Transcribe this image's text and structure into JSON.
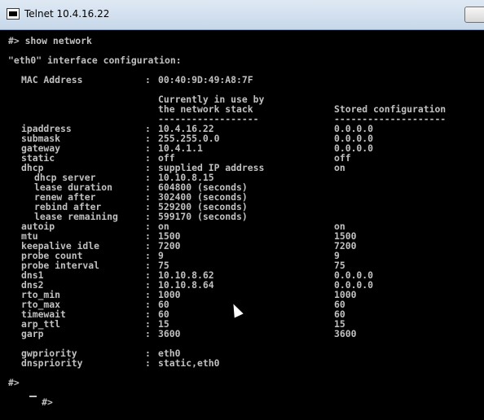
{
  "window": {
    "title": "Telnet 10.4.16.22"
  },
  "console": {
    "command_line": "#> show network",
    "header": "\"eth0\" interface configuration:",
    "mac": {
      "label": "MAC Address",
      "sep": ":",
      "value": "00:40:9D:49:A8:7F"
    },
    "col_current_1": "Currently in use by",
    "col_current_2": "the network stack",
    "col_stored": "Stored configuration",
    "divider_current": "------------------",
    "divider_stored": "--------------------",
    "rows": [
      {
        "label": "ipaddress",
        "indent": false,
        "current": "10.4.16.22",
        "stored": "0.0.0.0"
      },
      {
        "label": "submask",
        "indent": false,
        "current": "255.255.0.0",
        "stored": "0.0.0.0"
      },
      {
        "label": "gateway",
        "indent": false,
        "current": "10.4.1.1",
        "stored": "0.0.0.0"
      },
      {
        "label": "static",
        "indent": false,
        "current": "off",
        "stored": "off"
      },
      {
        "label": "dhcp",
        "indent": false,
        "current": "supplied IP address",
        "stored": "on"
      },
      {
        "label": "dhcp server",
        "indent": true,
        "current": "10.10.8.15",
        "stored": ""
      },
      {
        "label": "lease duration",
        "indent": true,
        "current": "604800 (seconds)",
        "stored": ""
      },
      {
        "label": "renew after",
        "indent": true,
        "current": "302400 (seconds)",
        "stored": ""
      },
      {
        "label": "rebind after",
        "indent": true,
        "current": "529200 (seconds)",
        "stored": ""
      },
      {
        "label": "lease remaining",
        "indent": true,
        "current": "599170 (seconds)",
        "stored": ""
      },
      {
        "label": "autoip",
        "indent": false,
        "current": "on",
        "stored": "on"
      },
      {
        "label": "mtu",
        "indent": false,
        "current": "1500",
        "stored": "1500"
      },
      {
        "label": "keepalive idle",
        "indent": false,
        "current": "7200",
        "stored": "7200"
      },
      {
        "label": "probe count",
        "indent": false,
        "current": "9",
        "stored": "9"
      },
      {
        "label": "probe interval",
        "indent": false,
        "current": "75",
        "stored": "75"
      },
      {
        "label": "dns1",
        "indent": false,
        "current": "10.10.8.62",
        "stored": "0.0.0.0"
      },
      {
        "label": "dns2",
        "indent": false,
        "current": "10.10.8.64",
        "stored": "0.0.0.0"
      },
      {
        "label": "rto_min",
        "indent": false,
        "current": "1000",
        "stored": "1000"
      },
      {
        "label": "rto_max",
        "indent": false,
        "current": "60",
        "stored": "60"
      },
      {
        "label": "timewait",
        "indent": false,
        "current": "60",
        "stored": "60"
      },
      {
        "label": "arp_ttl",
        "indent": false,
        "current": "15",
        "stored": "15"
      },
      {
        "label": "garp",
        "indent": false,
        "current": "3600",
        "stored": "3600"
      }
    ],
    "priorities": [
      {
        "label": "gwpriority",
        "value": "eth0"
      },
      {
        "label": "dnspriority",
        "value": "static,eth0"
      }
    ],
    "sep": ":",
    "prompt_1": "#>",
    "prompt_2": "#>"
  }
}
